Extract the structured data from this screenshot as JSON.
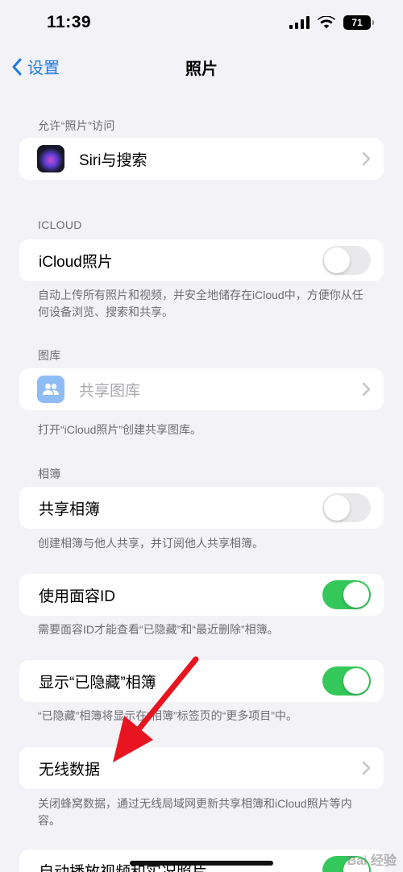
{
  "status": {
    "time": "11:39",
    "battery": "71"
  },
  "nav": {
    "back_label": "设置",
    "title": "照片"
  },
  "sections": {
    "allow_access": {
      "header": "允许“照片”访问",
      "siri_label": "Siri与搜索"
    },
    "icloud": {
      "header": "ICLOUD",
      "icloud_photos_label": "iCloud照片",
      "icloud_photos_on": false,
      "footer": "自动上传所有照片和视频，并安全地储存在iCloud中，方便你从任何设备浏览、搜索和共享。"
    },
    "library": {
      "header": "图库",
      "shared_library_label": "共享图库",
      "footer": "打开“iCloud照片”创建共享图库。"
    },
    "albums": {
      "header": "相簿",
      "shared_albums_label": "共享相簿",
      "shared_albums_on": false,
      "footer": "创建相簿与他人共享，并订阅他人共享相簿。"
    },
    "face_id": {
      "label": "使用面容ID",
      "on": true,
      "footer": "需要面容ID才能查看“已隐藏”和“最近删除”相簿。"
    },
    "hidden": {
      "label": "显示“已隐藏”相簿",
      "on": true,
      "footer": "“已隐藏”相簿将显示在“相簿”标签页的“更多项目”中。"
    },
    "wireless": {
      "label": "无线数据",
      "footer": "关闭蜂窝数据，通过无线局域网更新共享相簿和iCloud照片等内容。"
    },
    "autoplay": {
      "label": "自动播放视频和实况照片",
      "on": true
    }
  },
  "watermark": "Bai 经验",
  "colors": {
    "accent": "#1f7ae0",
    "toggle_on": "#34c759",
    "annotation_arrow": "#e8141f"
  }
}
